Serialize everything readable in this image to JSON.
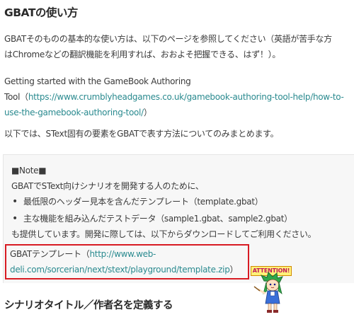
{
  "section_title": "GBATの使い方",
  "intro": {
    "line1": "GBATそのものの基本的な使い方は、以下のページを参照してください（英語が苦手な方",
    "line2": "はChromeなどの翻訳機能を利用すれば、おおよそ把握できる、はず！）。"
  },
  "reference": {
    "line1": "Getting started with the GameBook Authoring",
    "prefix": "Tool（",
    "link_part1": "https://www.crumblyheadgames.co.uk/gamebook-authoring-tool-help/how-to-",
    "link_part2": "use-the-gamebook-authoring-tool/",
    "suffix": "）"
  },
  "summary": "以下では、SText固有の要素をGBATで表す方法についてのみまとめます。",
  "note": {
    "header": "■Note■",
    "line1": "GBATでSText向けシナリオを開発する人のために、",
    "bullets": [
      "最低限のヘッダー見本を含んだテンプレート（template.gbat）",
      "主な機能を組み込んだテストデータ（sample1.gbat、sample2.gbat）"
    ],
    "line2": "も提供しています。開発に際しては、以下からダウンロードしてご利用ください。",
    "download": {
      "prefix": "GBATテンプレート（",
      "link_part1": "http://www.web-",
      "link_part2": "deli.com/sorcerian/next/stext/playground/template.zip",
      "suffix": "）"
    }
  },
  "attention_label": "ATTENTION!",
  "next_title": "シナリオタイトル／作者名を定義する",
  "colors": {
    "link": "#2a8a8f",
    "highlight_border": "#d81b23",
    "note_bg": "#f7f7f7"
  }
}
